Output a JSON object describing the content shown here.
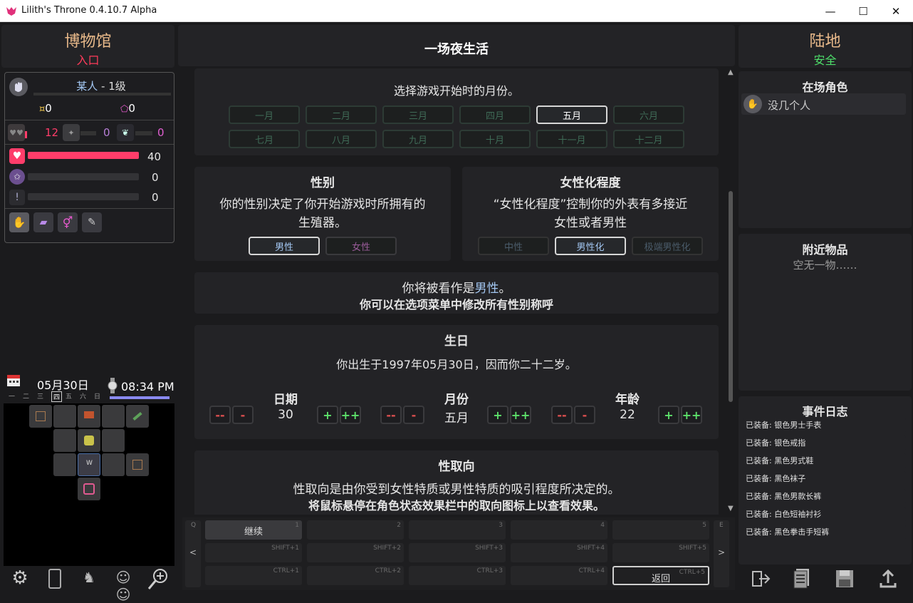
{
  "window": {
    "title": "Lilith's Throne 0.4.10.7 Alpha",
    "minimize": "—",
    "maximize": "☐",
    "close": "✕"
  },
  "left": {
    "location": "博物馆",
    "sublocation": "入口",
    "player": {
      "name": "某人",
      "level": " - 1级",
      "money": "0",
      "essence": "0",
      "stat1": "12",
      "stat2": "0",
      "stat3": "0",
      "health": "40",
      "health_fraction": 1.0,
      "mana": "0",
      "lust": "0"
    },
    "date": "05月30日",
    "time": "08:34 PM",
    "weekdays": [
      "一",
      "二",
      "三",
      "四",
      "五",
      "六",
      "日"
    ],
    "today_index": 3,
    "map_labels": {
      "w": "W"
    }
  },
  "center": {
    "header": "一场夜生活",
    "month_section": {
      "desc": "选择游戏开始时的月份。",
      "months": [
        "一月",
        "二月",
        "三月",
        "四月",
        "五月",
        "六月",
        "七月",
        "八月",
        "九月",
        "十月",
        "十一月",
        "十二月"
      ],
      "selected": "五月"
    },
    "gender": {
      "title": "性别",
      "desc1": "你的性别决定了你开始游戏时所拥有的",
      "desc2": "生殖器。",
      "male": "男性",
      "female": "女性"
    },
    "femininity": {
      "title": "女性化程度",
      "desc1": "“女性化程度”控制你的外表有多接近",
      "desc2": "女性或者男性",
      "opt1": "中性",
      "opt2": "男性化",
      "opt3": "极端男性化"
    },
    "perceived": {
      "line1a": "你将被看作是",
      "line1b": "男性",
      "line1c": "。",
      "line2": "你可以在选项菜单中修改所有性别称呼"
    },
    "birthday": {
      "title": "生日",
      "desc": "你出生于1997年05月30日，因而你二十二岁。",
      "day_label": "日期",
      "day_value": "30",
      "month_label": "月份",
      "month_value": "五月",
      "age_label": "年龄",
      "age_value": "22",
      "mm": "--",
      "m": "-",
      "p": "+",
      "pp": "++"
    },
    "orientation": {
      "title": "性取向",
      "desc1": "性取向是由你受到女性特质或男性特质的吸引程度所决定的。",
      "desc2": "将鼠标悬停在角色状态效果栏中的取向图标上以查看效果。"
    },
    "hotkeys": {
      "q": "Q",
      "e": "E",
      "prev": "<",
      "next": ">",
      "row1": [
        "1",
        "2",
        "3",
        "4",
        "5"
      ],
      "row2": [
        "SHIFT+1",
        "SHIFT+2",
        "SHIFT+3",
        "SHIFT+4",
        "SHIFT+5"
      ],
      "row3": [
        "CTRL+1",
        "CTRL+2",
        "CTRL+3",
        "CTRL+4",
        "CTRL+5"
      ],
      "continue": "继续",
      "back": "返回"
    }
  },
  "right": {
    "location": "陆地",
    "sublocation": "安全",
    "characters_title": "在场角色",
    "characters_empty": "没几个人",
    "items_title": "附近物品",
    "items_empty": "空无一物……",
    "log_title": "事件日志",
    "log": [
      "已装备: 银色男士手表",
      "已装备: 银色戒指",
      "已装备: 黑色男式鞋",
      "已装备: 黑色袜子",
      "已装备: 黑色男款长裤",
      "已装备: 白色短袖衬衫",
      "已装备: 黑色拳击手短裤"
    ]
  },
  "colors": {
    "accent_blue": "#a3c7f2",
    "health": "#ff3d6a",
    "safe": "#4ede6a",
    "entrance": "#ff3b5a",
    "loc": "#e8b98a"
  }
}
